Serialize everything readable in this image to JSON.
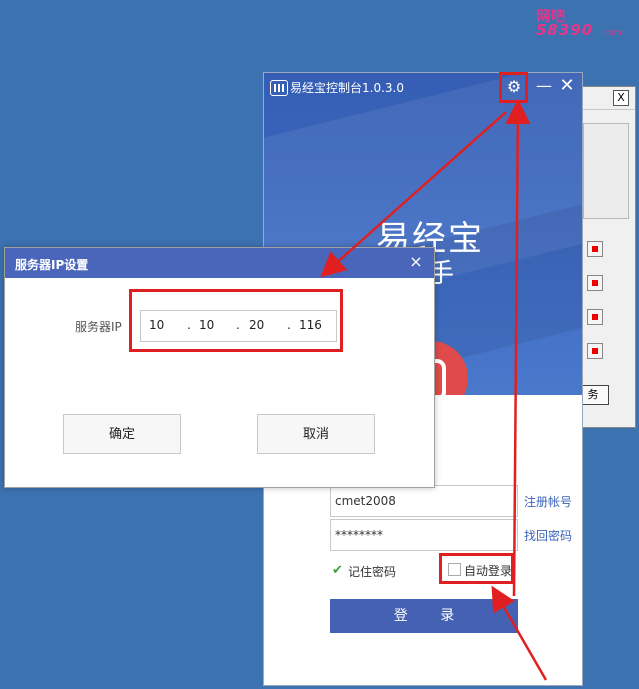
{
  "watermark": {
    "top": "网吧",
    "bottom": "58390",
    "sub": ".com"
  },
  "main_window": {
    "title": "易经宝控制台1.0.3.0",
    "gear_icon": "gear-icon",
    "minimize_icon": "minimize-icon",
    "close_icon": "close-icon",
    "brand": "易经宝",
    "tagline_partial": "理助手",
    "username_value": "cmet2008",
    "password_value": "********",
    "register_link": "注册帐号",
    "forgot_link": "找回密码",
    "remember_label": "记住密码",
    "auto_login_label": "自动登录",
    "login_button": "登 录"
  },
  "background_window": {
    "close_glyph": "X",
    "button_partial": "务"
  },
  "dialog": {
    "title": "服务器IP设置",
    "close_glyph": "×",
    "ip_label": "服务器IP",
    "ip_octets": [
      "10",
      "10",
      "20",
      "116"
    ],
    "ok_button": "确定",
    "cancel_button": "取消"
  },
  "colors": {
    "desktop": "#3d72b0",
    "accent_blue": "#4461b4",
    "annotation_red": "#e02020",
    "avatar_red": "#e14a4a",
    "check_green": "#3aa13a"
  }
}
